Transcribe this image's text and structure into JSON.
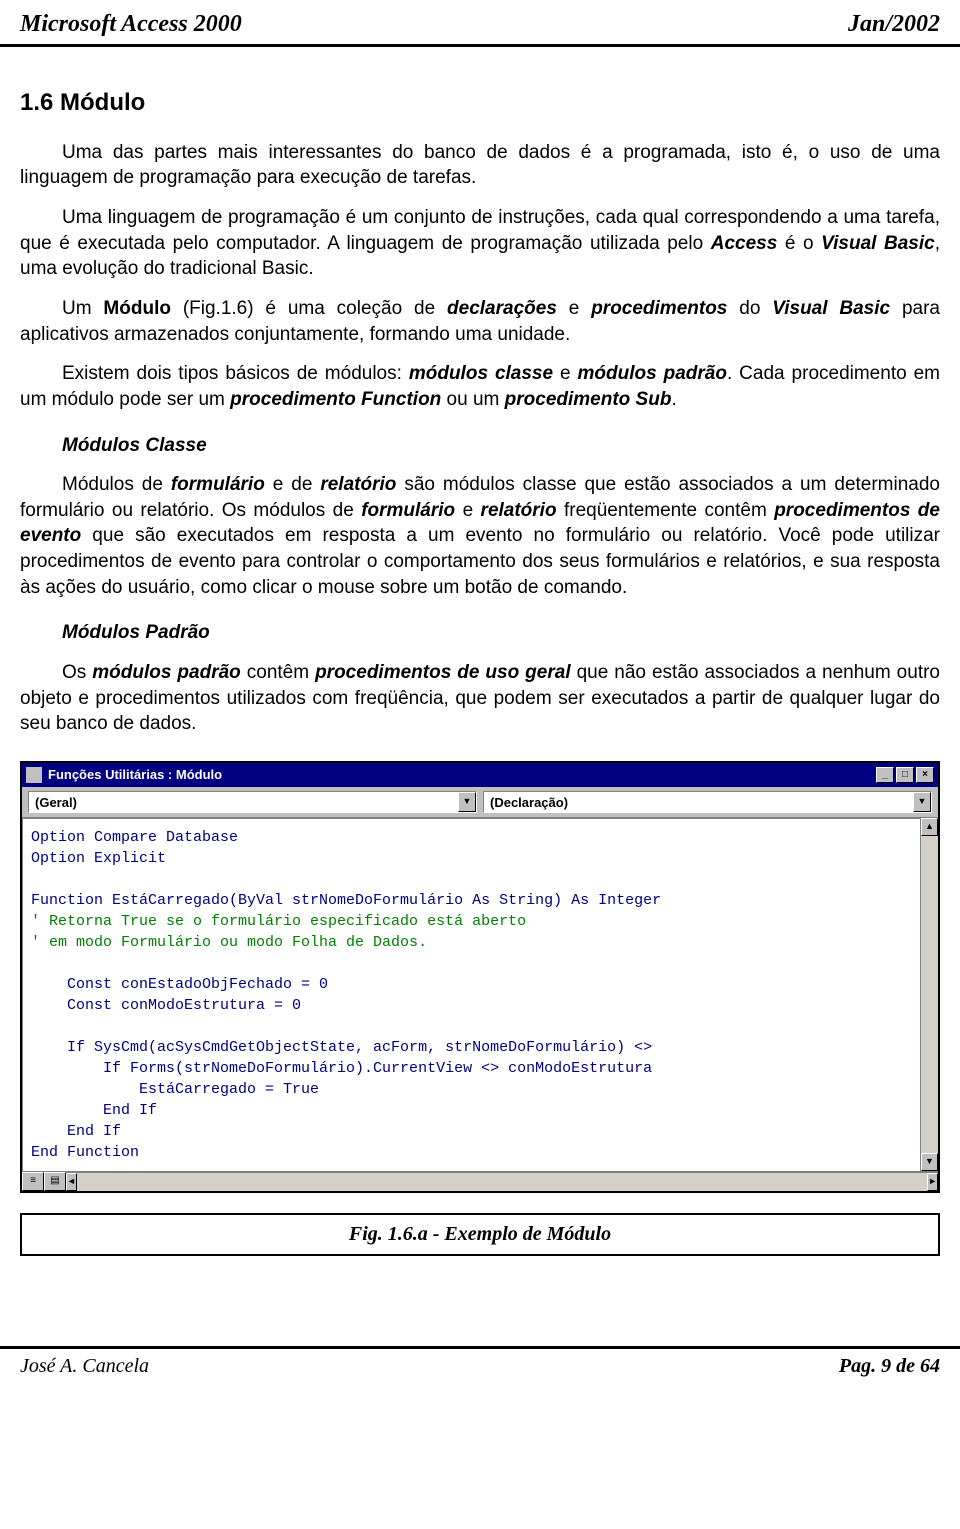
{
  "header": {
    "left": "Microsoft Access 2000",
    "right": "Jan/2002"
  },
  "section_title": "1.6  Módulo",
  "paragraphs": {
    "p1": "Uma das partes mais interessantes do banco de dados é a programada, isto é, o uso de uma linguagem de programação para execução de tarefas.",
    "p2a": "Uma linguagem de programação é um conjunto de instruções, cada qual correspondendo a uma tarefa, que é executada pelo computador. A linguagem de programação utilizada pelo ",
    "p2b": "Access",
    "p2c": " é o ",
    "p2d": "Visual Basic",
    "p2e": ", uma evolução do  tradicional Basic.",
    "p3a": "Um ",
    "p3b": "Módulo",
    "p3c": " (Fig.1.6) é uma coleção de ",
    "p3d": "declarações",
    "p3e": " e ",
    "p3f": "procedimentos",
    "p3g": " do ",
    "p3h": "Visual Basic",
    "p3i": " para aplicativos armazenados conjuntamente, formando uma unidade.",
    "p4a": "Existem dois tipos básicos de módulos: ",
    "p4b": "módulos classe",
    "p4c": " e ",
    "p4d": "módulos padrão",
    "p4e": ". Cada procedimento em um módulo pode ser um ",
    "p4f": "procedimento Function",
    "p4g": " ou um ",
    "p4h": "procedimento Sub",
    "p4i": "."
  },
  "sub1_title": "Módulos Classe",
  "sub1": {
    "a": "Módulos de ",
    "b": "formulário",
    "c": " e de ",
    "d": "relatório",
    "e": " são módulos classe que estão associados a um determinado formulário ou relatório. Os módulos de ",
    "f": "formulário",
    "g": " e ",
    "h": "relatório",
    "i": " freqüentemente contêm ",
    "j": "procedimentos de evento",
    "k": " que são executados em resposta a um evento no formulário ou relatório. Você pode utilizar procedimentos de evento para controlar o comportamento dos seus formulários e relatórios, e sua resposta às ações do usuário, como clicar o mouse sobre um botão de comando."
  },
  "sub2_title": "Módulos Padrão",
  "sub2": {
    "a": "Os ",
    "b": "módulos padrão",
    "c": " contêm ",
    "d": "procedimentos de uso geral",
    "e": " que não estão associados a nenhum outro objeto e procedimentos utilizados com freqüência, que podem ser executados a partir de qualquer lugar do seu banco de dados."
  },
  "vbwindow": {
    "title": "Funções Utilitárias : Módulo",
    "min": "_",
    "max": "□",
    "close": "×",
    "combo1": "(Geral)",
    "combo2": "(Declaração)",
    "code_lines": [
      {
        "t": "kw",
        "s": "Option Compare Database"
      },
      {
        "t": "kw",
        "s": "Option Explicit"
      },
      {
        "t": "",
        "s": ""
      },
      {
        "t": "kw",
        "s": "Function EstáCarregado(ByVal strNomeDoFormulário As String) As Integer"
      },
      {
        "t": "cmt",
        "s": "' Retorna True se o formulário especificado está aberto"
      },
      {
        "t": "cmt",
        "s": "' em modo Formulário ou modo Folha de Dados."
      },
      {
        "t": "",
        "s": ""
      },
      {
        "t": "kw",
        "s": "    Const conEstadoObjFechado = 0"
      },
      {
        "t": "kw",
        "s": "    Const conModoEstrutura = 0"
      },
      {
        "t": "",
        "s": ""
      },
      {
        "t": "kw",
        "s": "    If SysCmd(acSysCmdGetObjectState, acForm, strNomeDoFormulário) <> "
      },
      {
        "t": "kw",
        "s": "        If Forms(strNomeDoFormulário).CurrentView <> conModoEstrutura "
      },
      {
        "t": "kw",
        "s": "            EstáCarregado = True"
      },
      {
        "t": "kw",
        "s": "        End If"
      },
      {
        "t": "kw",
        "s": "    End If"
      },
      {
        "t": "kw",
        "s": "End Function"
      }
    ]
  },
  "caption": "Fig. 1.6.a - Exemplo de Módulo",
  "footer": {
    "author": "José A. Cancela",
    "page": "Pag. 9 de 64"
  }
}
